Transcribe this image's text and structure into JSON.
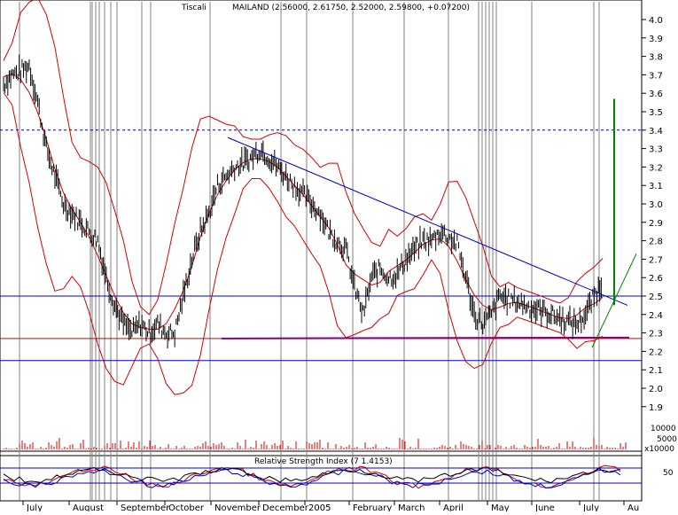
{
  "header": {
    "title": "MAILAND (2.56000, 2.61750, 2.52000, 2.59800, +0.07200)",
    "left_label": "Tiscali"
  },
  "colors": {
    "price": "#000000",
    "bollinger": "#d40000",
    "trend_blue": "#0000cc",
    "support_red": "#cc0000",
    "support_purple": "#800080",
    "spike": "#008000",
    "grid": "#808080",
    "resistance_dash": "#000080"
  },
  "volume_panel": {
    "ticks": [
      "10000",
      "5000"
    ],
    "unit": "x10000"
  },
  "rsi_panel": {
    "title": "Relative Strength Index (7 1.4153)",
    "tick": "50"
  },
  "chart_data": {
    "type": "line",
    "title": "MAILAND (2.56000, 2.61750, 2.52000, 2.59800, +0.07200)",
    "ylim": [
      1.8,
      4.0
    ],
    "y_ticks": [
      "4.0",
      "3.9",
      "3.8",
      "3.7",
      "3.6",
      "3.5",
      "3.4",
      "3.3",
      "3.2",
      "3.1",
      "3.0",
      "2.9",
      "2.8",
      "2.7",
      "2.6",
      "2.5",
      "2.4",
      "2.3",
      "2.2",
      "2.1",
      "2.0",
      "1.9"
    ],
    "x_labels": [
      "July",
      "August",
      "September",
      "October",
      "November",
      "December",
      "2005",
      "February",
      "March",
      "April",
      "May",
      "June",
      "July",
      "Au"
    ],
    "series": [
      {
        "values": [
          3.65,
          3.7,
          3.72,
          3.75,
          3.55,
          3.3,
          3.15,
          3.0,
          2.95,
          2.9,
          2.85,
          2.8,
          2.6,
          2.45,
          2.35,
          2.3,
          2.35,
          2.3,
          2.35,
          2.3,
          2.3,
          2.5,
          2.7,
          2.85,
          2.95,
          3.1,
          3.15,
          3.2,
          3.22,
          3.25,
          3.3,
          3.25,
          3.2,
          3.15,
          3.1,
          3.05,
          3.0,
          2.95,
          2.85,
          2.8,
          2.75,
          2.55,
          2.4,
          2.6,
          2.65,
          2.6,
          2.62,
          2.7,
          2.75,
          2.8,
          2.8,
          2.85,
          2.82,
          2.78,
          2.6,
          2.4,
          2.35,
          2.4,
          2.5,
          2.48,
          2.47,
          2.45,
          2.43,
          2.42,
          2.4,
          2.38,
          2.36,
          2.35,
          2.4,
          2.5,
          2.58
        ]
      }
    ],
    "resistance_level": 3.4,
    "support_levels": [
      2.5,
      2.27,
      2.15
    ],
    "grid": true
  }
}
